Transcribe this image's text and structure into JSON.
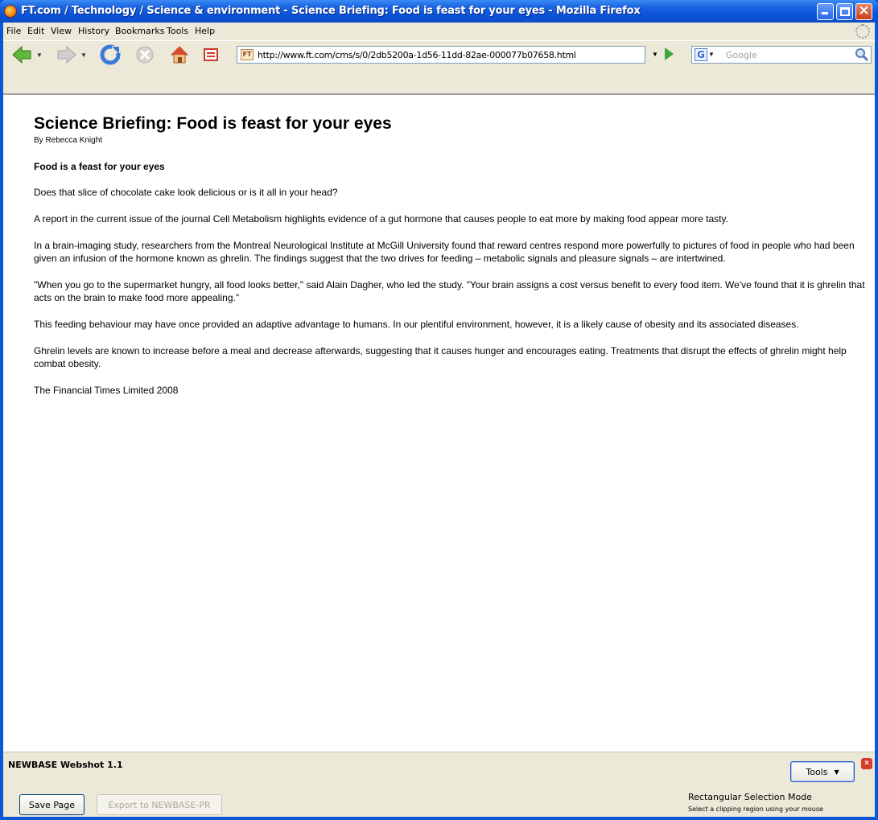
{
  "window": {
    "title": "FT.com / Technology / Science & environment - Science Briefing: Food is feast for your eyes - Mozilla Firefox"
  },
  "menu": [
    "File",
    "Edit",
    "View",
    "History",
    "Bookmarks",
    "Tools",
    "Help"
  ],
  "toolbar": {
    "favicon_text": "FT",
    "url": "http://www.ft.com/cms/s/0/2db5200a-1d56-11dd-82ae-000077b07658.html",
    "search_engine": "G",
    "search_placeholder": "Google"
  },
  "article": {
    "headline": "Science Briefing: Food is feast for your eyes",
    "byline": "By Rebecca Knight",
    "subhead": "Food is a feast for your eyes",
    "paragraphs": [
      "Does that slice of chocolate cake look delicious or is it all in your head?",
      "A report in the current issue of the journal Cell Metabolism highlights evidence of a gut hormone that causes people to eat more by making food appear more tasty.",
      "In a brain-imaging study, researchers from the Montreal Neurological Institute at McGill University found that reward centres respond more powerfully to pictures of food in people who had been given an infusion of the hormone known as ghrelin. The findings suggest that the two drives for feeding – metabolic signals and pleasure signals – are intertwined.",
      "\"When you go to the supermarket hungry, all food looks better,\" said Alain Dagher, who led the study. \"Your brain assigns a cost versus benefit to every food item. We've found that it is ghrelin that acts on the brain to make food more appealing.\"",
      "This feeding behaviour may have once provided an adaptive advantage to humans. In our plentiful environment, however, it is a likely cause of obesity and its associated diseases.",
      "Ghrelin levels are known to increase before a meal and decrease afterwards, suggesting that it causes hunger and encourages eating. Treatments that disrupt the effects of ghrelin might help combat obesity.",
      "The Financial Times Limited 2008"
    ]
  },
  "panel": {
    "title": "NEWBASE Webshot 1.1",
    "save_label": "Save Page",
    "export_label": "Export to NEWBASE-PR",
    "tools_label": "Tools",
    "mode_title": "Rectangular Selection Mode",
    "mode_desc": "Select a clipping region using your mouse"
  }
}
